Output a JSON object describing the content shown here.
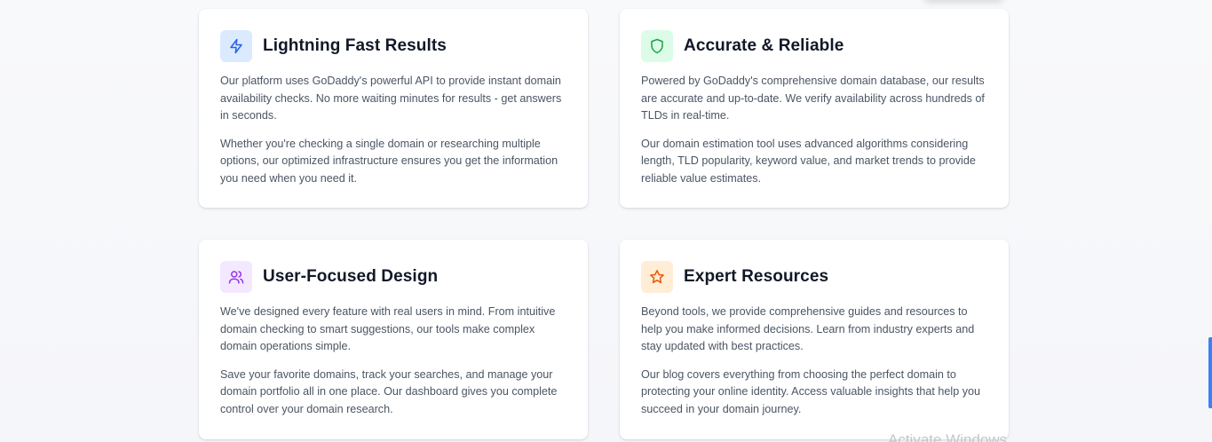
{
  "cards": [
    {
      "title": "Lightning Fast Results",
      "icon": "lightning-icon",
      "icon_bg": "#dbeafe",
      "icon_color": "#2563eb",
      "paragraph1": "Our platform uses GoDaddy's powerful API to provide instant domain availability checks. No more waiting minutes for results - get answers in seconds.",
      "paragraph2": "Whether you're checking a single domain or researching multiple options, our optimized infrastructure ensures you get the information you need when you need it."
    },
    {
      "title": "Accurate & Reliable",
      "icon": "shield-icon",
      "icon_bg": "#dcfce7",
      "icon_color": "#16a34a",
      "paragraph1": "Powered by GoDaddy's comprehensive domain database, our results are accurate and up-to-date. We verify availability across hundreds of TLDs in real-time.",
      "paragraph2": "Our domain estimation tool uses advanced algorithms considering length, TLD popularity, keyword value, and market trends to provide reliable value estimates."
    },
    {
      "title": "User-Focused Design",
      "icon": "users-icon",
      "icon_bg": "#f3e8ff",
      "icon_color": "#9333ea",
      "paragraph1": "We've designed every feature with real users in mind. From intuitive domain checking to smart suggestions, our tools make complex domain operations simple.",
      "paragraph2": "Save your favorite domains, track your searches, and manage your domain portfolio all in one place. Our dashboard gives you complete control over your domain research."
    },
    {
      "title": "Expert Resources",
      "icon": "star-icon",
      "icon_bg": "#ffedd5",
      "icon_color": "#ea580c",
      "paragraph1": "Beyond tools, we provide comprehensive guides and resources to help you make informed decisions. Learn from industry experts and stay updated with best practices.",
      "paragraph2": "Our blog covers everything from choosing the perfect domain to protecting your online identity. Access valuable insights that help you succeed in your domain journey."
    }
  ],
  "watermark": "Activate Windows"
}
